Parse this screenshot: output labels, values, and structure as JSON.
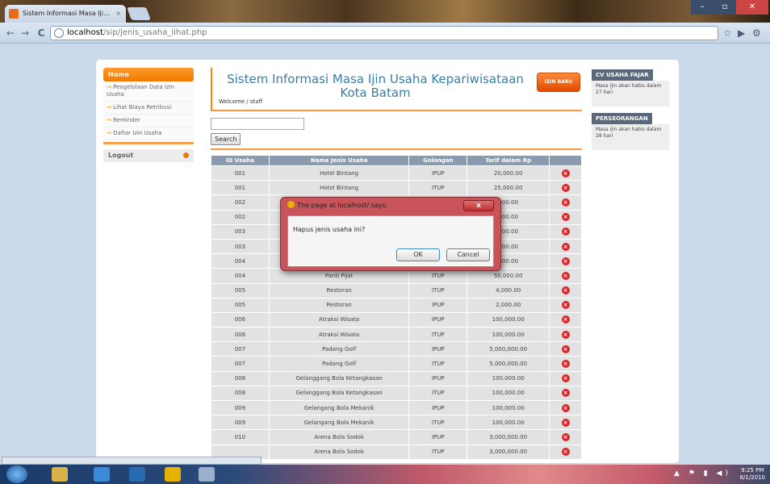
{
  "browser": {
    "tab_title": "Sistem Informasi Masa Iji...",
    "tab_close": "×",
    "url_host": "localhost",
    "url_path": "/sip/jenis_usaha_lihat.php",
    "back": "←",
    "forward": "→",
    "reload": "C",
    "star": "☆"
  },
  "leftmenu": {
    "home": "Home",
    "items": [
      "Pengelolaan Data Izin Usaha",
      "Lihat Biaya Retribusi",
      "Reminder",
      "Daftar Izin Usaha"
    ],
    "logout": "Logout"
  },
  "header": {
    "title": "Sistem Informasi Masa Ijin Usaha Kepariwisataan Kota Batam",
    "izin_baru": "IZIN BARU",
    "welcome": "Welcome / staff"
  },
  "search": {
    "button": "Search",
    "value": ""
  },
  "table": {
    "headers": [
      "ID Usaha",
      "Nama Jenis Usaha",
      "Golongan",
      "Tarif dalam Rp",
      ""
    ],
    "rows": [
      [
        "001",
        "Hotel Bintang",
        "IPUP",
        "20,000.00"
      ],
      [
        "001",
        "Hotel Bintang",
        "ITUP",
        "25,000.00"
      ],
      [
        "002",
        "",
        "",
        "000.00"
      ],
      [
        "002",
        "",
        "",
        "000.00"
      ],
      [
        "003",
        "",
        "",
        "000.00"
      ],
      [
        "003",
        "",
        "",
        "000.00"
      ],
      [
        "004",
        "",
        "",
        "000.00"
      ],
      [
        "004",
        "Panti Pijat",
        "ITUP",
        "50,000.00"
      ],
      [
        "005",
        "Restoran",
        "ITUP",
        "4,000.00"
      ],
      [
        "005",
        "Restoran",
        "IPUP",
        "2,000.00"
      ],
      [
        "006",
        "Atraksi Wisata",
        "IPUP",
        "100,000.00"
      ],
      [
        "006",
        "Atraksi Wisata",
        "ITUP",
        "100,000.00"
      ],
      [
        "007",
        "Padang Golf",
        "IPUP",
        "5,000,000.00"
      ],
      [
        "007",
        "Padang Golf",
        "ITUP",
        "5,000,000.00"
      ],
      [
        "008",
        "Gelanggang Bola Ketangkasan",
        "IPUP",
        "100,000.00"
      ],
      [
        "008",
        "Gelanggang Bola Ketangkasan",
        "ITUP",
        "100,000.00"
      ],
      [
        "009",
        "Gelangang Bola Mekanik",
        "IPUP",
        "100,000.00"
      ],
      [
        "009",
        "Gelangang Bola Mekanik",
        "ITUP",
        "100,000.00"
      ],
      [
        "010",
        "Arena Bola Sodok",
        "IPUP",
        "3,000,000.00"
      ],
      [
        "",
        "Arena Bola Sodok",
        "ITUP",
        "3,000,000.00"
      ]
    ]
  },
  "rightpanel": [
    {
      "title": "CV USAHA FAJAR",
      "text": "Masa ijin akan habis dalam 27 hari"
    },
    {
      "title": "PERSEORANGAN",
      "text": "Masa ijin akan habis dalam 28 hari"
    }
  ],
  "dialog": {
    "title": "The page at localhost/ says:",
    "message": "Hapus jenis usaha ini?",
    "ok": "OK",
    "cancel": "Cancel",
    "close": "x"
  },
  "taskbar": {
    "time": "9:25 PM",
    "date": "8/1/2010"
  },
  "colors": {
    "accent": "#f07a00",
    "title_blue": "#3a7ea6",
    "table_header": "#8a9bb0",
    "delete_red": "#d9262c"
  }
}
